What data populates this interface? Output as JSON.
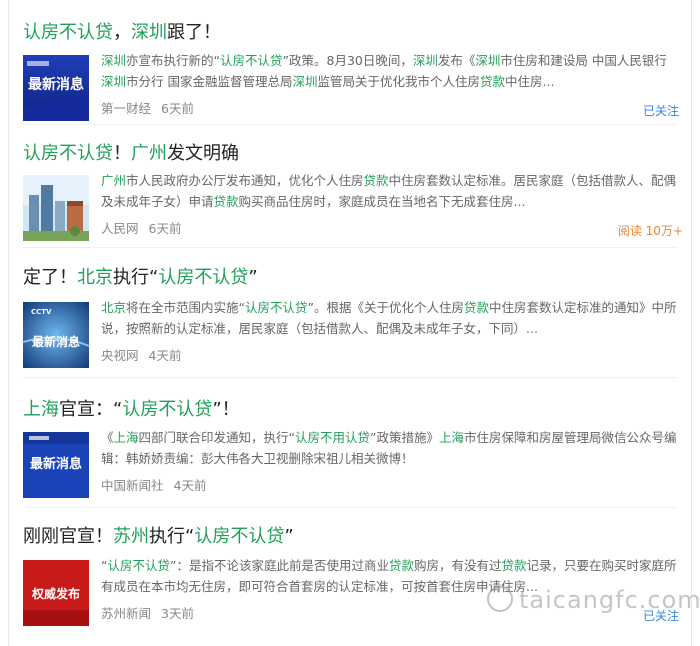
{
  "items": [
    {
      "title": [
        [
          "认房不认贷",
          true
        ],
        [
          "，",
          false
        ],
        [
          "深圳",
          true
        ],
        [
          "跟了！",
          false
        ]
      ],
      "thumb_label": "最新消息",
      "snippet": [
        [
          "深圳",
          true
        ],
        [
          "亦宣布执行新的“",
          false
        ],
        [
          "认房不认贷",
          true
        ],
        [
          "”政策。8月30日晚间，",
          false
        ],
        [
          "深圳",
          true
        ],
        [
          "发布《",
          false
        ],
        [
          "深圳",
          true
        ],
        [
          "市住房和建设局 中国人民银行",
          false
        ],
        [
          "深圳",
          true
        ],
        [
          "市分行 国家金融监督管理总局",
          false
        ],
        [
          "深圳",
          true
        ],
        [
          "监管局关于优化我市个人住房",
          false
        ],
        [
          "贷款",
          true
        ],
        [
          "中住房...",
          false
        ]
      ],
      "source": "第一财经",
      "time": "6天前",
      "follow": "已关注"
    },
    {
      "title": [
        [
          "认房不认贷",
          true
        ],
        [
          "！",
          false
        ],
        [
          "广州",
          true
        ],
        [
          "发文明确",
          false
        ]
      ],
      "snippet": [
        [
          "广州",
          true
        ],
        [
          "市人民政府办公厅发布通知，优化个人住房",
          false
        ],
        [
          "贷款",
          true
        ],
        [
          "中住房套数认定标准。居民家庭（包括借款人、配偶及未成年子女）申请",
          false
        ],
        [
          "贷款",
          true
        ],
        [
          "购买商品住房时，家庭成员在当地名下无成套住房...",
          false
        ]
      ],
      "source": "人民网",
      "time": "6天前",
      "reads": "阅读 10万+"
    },
    {
      "title": [
        [
          "定了！",
          false
        ],
        [
          "北京",
          true
        ],
        [
          "执行“",
          false
        ],
        [
          "认房不认贷",
          true
        ],
        [
          "”",
          false
        ]
      ],
      "thumb_label": "最新消息",
      "thumb_tag": "CCTV",
      "snippet": [
        [
          "北京",
          true
        ],
        [
          "将在全市范围内实施“",
          false
        ],
        [
          "认房不认贷",
          true
        ],
        [
          "”。根据《关于优化个人住房",
          false
        ],
        [
          "贷款",
          true
        ],
        [
          "中住房套数认定标准的通知》中所说，按照新的认定标准，居民家庭（包括借款人、配偶及未成年子女，下同）...",
          false
        ]
      ],
      "source": "央视网",
      "time": "4天前"
    },
    {
      "title": [
        [
          "上海",
          true
        ],
        [
          "官宣：“",
          false
        ],
        [
          "认房不认贷",
          true
        ],
        [
          "”！",
          false
        ]
      ],
      "thumb_label": "最新消息",
      "snippet": [
        [
          "《",
          false
        ],
        [
          "上海",
          true
        ],
        [
          "四部门联合印发通知，执行“",
          false
        ],
        [
          "认房不用认贷",
          true
        ],
        [
          "”政策措施》",
          false
        ],
        [
          "上海",
          true
        ],
        [
          "市住房保障和房屋管理局微信公众号编辑：韩娇娇责编：彭大伟各大卫视删除宋祖儿相关微博！",
          false
        ]
      ],
      "source": "中国新闻社",
      "time": "4天前"
    },
    {
      "title": [
        [
          "刚刚官宣！",
          false
        ],
        [
          "苏州",
          true
        ],
        [
          "执行“",
          false
        ],
        [
          "认房不认贷",
          true
        ],
        [
          "”",
          false
        ]
      ],
      "thumb_label": "权威发布",
      "snippet": [
        [
          "“",
          false
        ],
        [
          "认房不认贷",
          true
        ],
        [
          "”：是指不论该家庭此前是否使用过商业",
          false
        ],
        [
          "贷款",
          true
        ],
        [
          "购房，有没有过",
          false
        ],
        [
          "贷款",
          true
        ],
        [
          "记录，只要在购买时家庭所有成员在本市均无住房，即可符合首套房的认定标准，可按首套住房申请住房...",
          false
        ]
      ],
      "source": "苏州新闻",
      "time": "3天前",
      "follow": "已关注"
    }
  ],
  "watermark": "taicangfc.com",
  "colors": {
    "highlight": "#21a05a",
    "follow": "#3a86d9",
    "reads": "#e8863a"
  }
}
